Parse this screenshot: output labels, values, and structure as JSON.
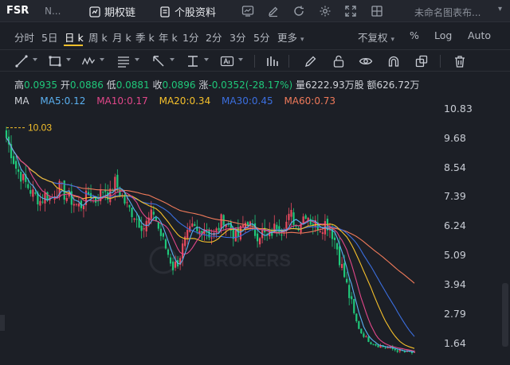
{
  "topbar": {
    "symbol": "FSR",
    "symbol_sub": "N...",
    "options_chain": "期权链",
    "stock_profile": "个股资料",
    "untitled_chart": "未命名图表布..."
  },
  "periods": {
    "items": [
      "分时",
      "5日",
      "日 k",
      "周 k",
      "月 k",
      "季 k",
      "年 k",
      "1分",
      "2分",
      "3分",
      "5分",
      "更多"
    ],
    "active": "日 k",
    "adjust": "不复权",
    "percent": "%",
    "log": "Log",
    "auto": "Auto"
  },
  "stats": {
    "high_label": "高",
    "high": "0.0935",
    "open_label": "开",
    "open": "0.0886",
    "low_label": "低",
    "low": "0.0881",
    "close_label": "收",
    "close": "0.0896",
    "change_label": "涨",
    "change": "-0.0352(-28.17%)",
    "volume_label": "量",
    "volume": "6222.93万股",
    "amount_label": "额",
    "amount": "626.72万"
  },
  "ma": {
    "label": "MA",
    "ma5": "MA5:0.12",
    "ma10": "MA10:0.17",
    "ma20": "MA20:0.34",
    "ma30": "MA30:0.45",
    "ma60": "MA60:0.73"
  },
  "colors": {
    "up": "#e84a5f",
    "down": "#1fc87a",
    "ma5": "#5ab0f0",
    "ma10": "#e2478a",
    "ma20": "#f5c02b",
    "ma30": "#3b6fe0",
    "ma60": "#f07a5a",
    "highlight": "#f5c02b"
  },
  "chart": {
    "y_ticks": [
      "10.83",
      "9.68",
      "8.54",
      "7.39",
      "6.24",
      "5.09",
      "3.94",
      "2.79",
      "1.64"
    ],
    "max_marker": "10.03",
    "watermark": "BROKERS"
  },
  "chart_data": {
    "type": "candlestick",
    "ylim": [
      1.2,
      11.2
    ],
    "y_ticks": [
      10.83,
      9.68,
      8.54,
      7.39,
      6.24,
      5.09,
      3.94,
      2.79,
      1.64
    ],
    "annotations": [
      {
        "text": "10.03",
        "value": 10.03
      }
    ],
    "close_trend": [
      9.7,
      9.1,
      8.5,
      8.2,
      7.9,
      7.6,
      7.4,
      7.2,
      7.5,
      7.3,
      7.6,
      7.8,
      7.4,
      7.3,
      7.1,
      7.0,
      7.3,
      7.6,
      7.2,
      7.5,
      7.7,
      7.4,
      8.0,
      7.6,
      7.2,
      6.9,
      6.7,
      6.4,
      6.2,
      6.5,
      6.8,
      6.1,
      5.6,
      5.1,
      4.6,
      4.9,
      5.5,
      5.9,
      6.2,
      5.9,
      6.3,
      6.0,
      5.8,
      6.1,
      6.6,
      6.3,
      6.0,
      5.8,
      6.2,
      6.5,
      6.1,
      5.9,
      6.0,
      5.8,
      6.0,
      6.3,
      6.1,
      6.4,
      6.7,
      6.2,
      6.5,
      6.8,
      6.4,
      6.3,
      6.2,
      6.4,
      6.1,
      5.6,
      4.8,
      4.1,
      3.3,
      2.6,
      2.1,
      1.9,
      1.7,
      1.6,
      1.55,
      1.5,
      1.45,
      1.4,
      1.35,
      1.3,
      1.3,
      1.25
    ],
    "series": [
      {
        "name": "MA5",
        "value_last": 0.12
      },
      {
        "name": "MA10",
        "value_last": 0.17
      },
      {
        "name": "MA20",
        "value_last": 0.34
      },
      {
        "name": "MA30",
        "value_last": 0.45
      },
      {
        "name": "MA60",
        "value_last": 0.73
      }
    ]
  }
}
